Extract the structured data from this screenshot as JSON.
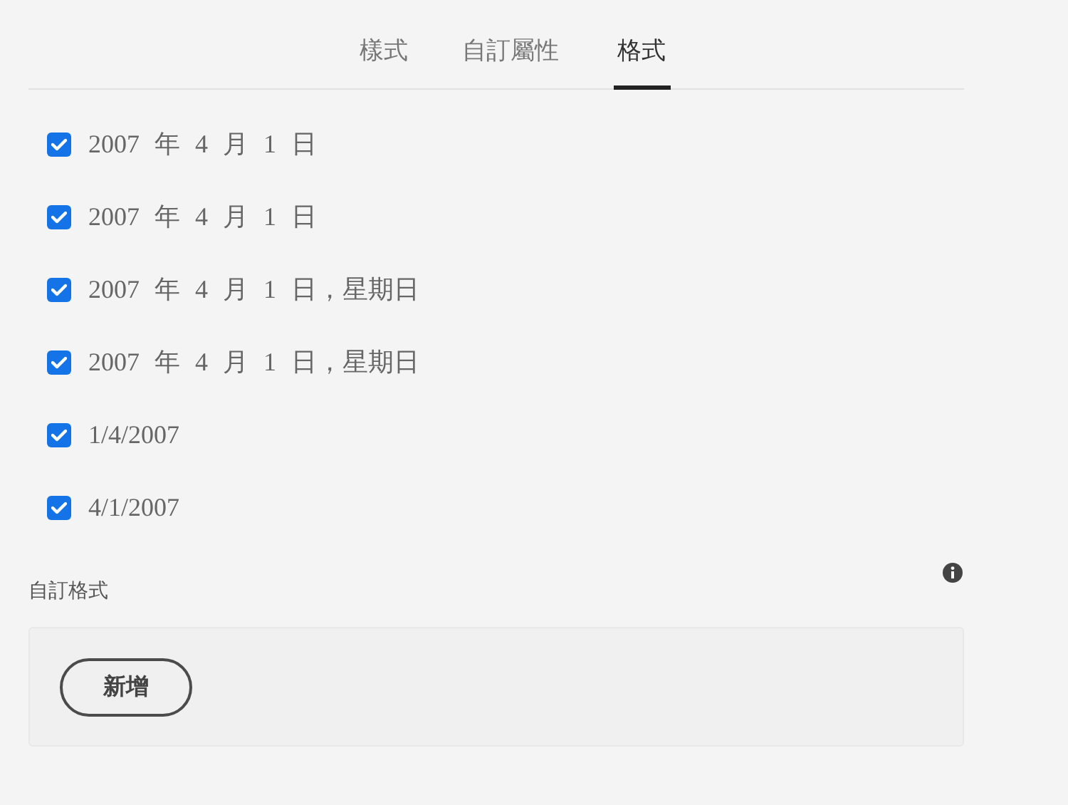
{
  "tabs": [
    {
      "label": "樣式",
      "selected": false
    },
    {
      "label": "自訂屬性",
      "selected": false
    },
    {
      "label": "格式",
      "selected": true
    }
  ],
  "formats": [
    {
      "label": "2007 年 4 月 1 日",
      "checked": true
    },
    {
      "label": "2007 年 4 月 1 日",
      "checked": true
    },
    {
      "label": "2007 年 4 月 1 日，星期日",
      "checked": true
    },
    {
      "label": "2007 年 4 月 1 日，星期日",
      "checked": true
    },
    {
      "label": "1/4/2007",
      "checked": true
    },
    {
      "label": "4/1/2007",
      "checked": true
    }
  ],
  "custom_format": {
    "label": "自訂格式",
    "button": "新增"
  }
}
